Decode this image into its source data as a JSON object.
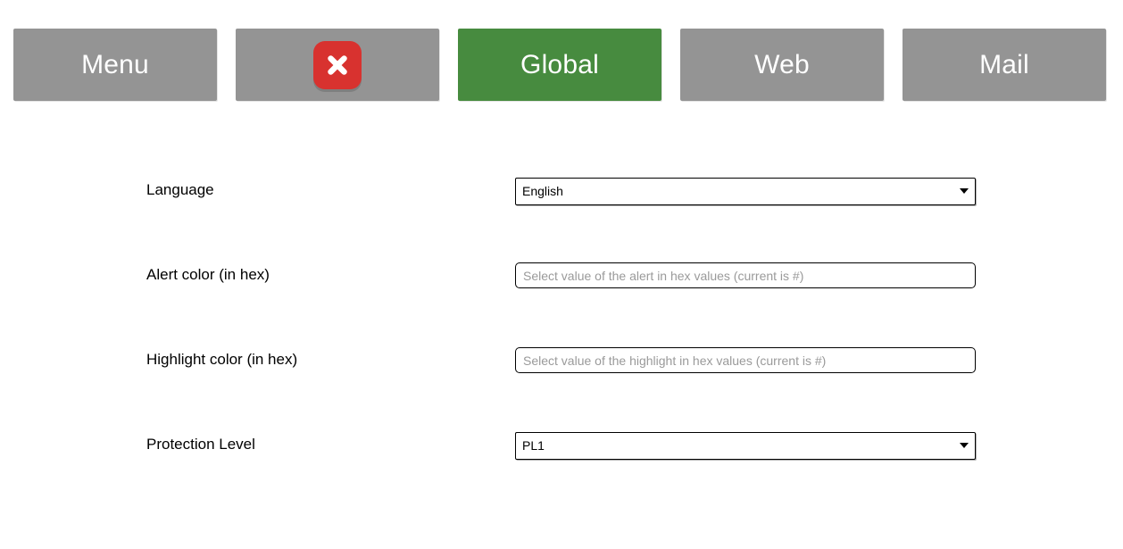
{
  "navbar": {
    "items": [
      {
        "label": "Menu",
        "type": "text",
        "active": false,
        "name": "menu"
      },
      {
        "label": "",
        "type": "icon",
        "icon": "close-x-icon",
        "active": false,
        "name": "close"
      },
      {
        "label": "Global",
        "type": "text",
        "active": true,
        "name": "global"
      },
      {
        "label": "Web",
        "type": "text",
        "active": false,
        "name": "web"
      },
      {
        "label": "Mail",
        "type": "text",
        "active": false,
        "name": "mail"
      }
    ]
  },
  "colors": {
    "button_grey": "#949494",
    "button_active_green": "#478b3f",
    "close_badge_red": "#d8322f",
    "label_text": "#000000",
    "placeholder_text": "#9a9a9a",
    "page_background": "#ffffff"
  },
  "form": {
    "rows": [
      {
        "label": "Language",
        "control": "select",
        "value": "English"
      },
      {
        "label": "Alert color (in hex)",
        "control": "text",
        "value": "",
        "placeholder": "Select value of the alert in hex values (current is #)"
      },
      {
        "label": "Highlight color (in hex)",
        "control": "text",
        "value": "",
        "placeholder": "Select value of the highlight in hex values (current is #)"
      },
      {
        "label": "Protection Level",
        "control": "select",
        "value": "PL1"
      }
    ]
  }
}
